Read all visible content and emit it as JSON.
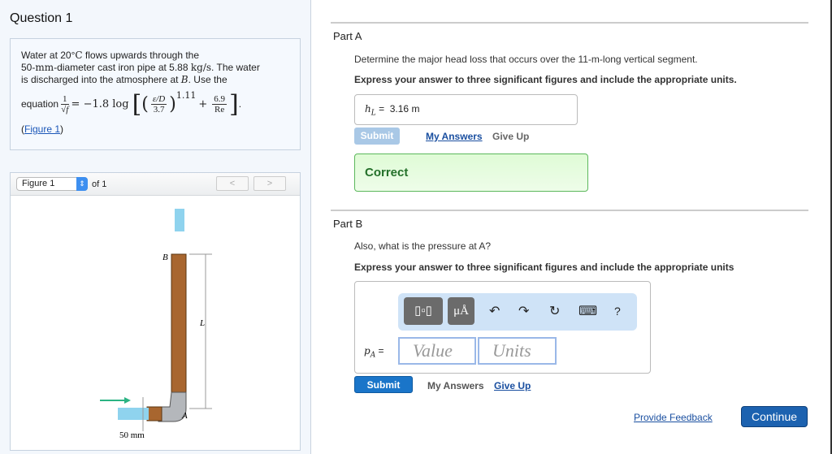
{
  "question_title": "Question 1",
  "problem": {
    "line1a": "Water at 20",
    "line1deg": "°",
    "line1C": "C",
    "line1b": " flows upwards through the",
    "line2a": "50-",
    "line2mm": "mm",
    "line2b": "-diameter cast iron pipe at 5.88 ",
    "line2unit": "kg/s",
    "line2c": ". The water",
    "line3a": "is discharged into the atmosphere at ",
    "line3B": "B",
    "line3b": ". Use the",
    "eq_label": "equation",
    "eq_num": "1",
    "eq_den": "√f",
    "eq_mid": "= −1.8 log",
    "eq_inner_num": "ε/D",
    "eq_inner_den": "3.7",
    "eq_exp": "1.11",
    "eq_plus": "+",
    "eq_re_num": "6.9",
    "eq_re_den": "Re",
    "figure_link": "Figure 1"
  },
  "figure": {
    "select": "Figure 1",
    "of": "of 1",
    "prev": "<",
    "next": ">",
    "labels": {
      "B": "B",
      "L": "L",
      "A": "A",
      "dia": "50 mm"
    }
  },
  "partA": {
    "title": "Part A",
    "prompt": "Determine the major head loss that occurs over the 11-m-long vertical segment.",
    "instruction": "Express your answer to three significant figures and include the appropriate units.",
    "var": "h",
    "sub": "L",
    "eq": "=",
    "answer": "3.16 m",
    "submit": "Submit",
    "my_answers": "My Answers",
    "give_up": "Give Up",
    "result": "Correct"
  },
  "partB": {
    "title": "Part B",
    "prompt": "Also, what is the pressure at A?",
    "instruction": "Express your answer to three significant figures and include the appropriate units",
    "toolbar": {
      "units": "μÅ",
      "undo": "↶",
      "redo": "↷",
      "reset": "↻",
      "keyboard": "⌨",
      "help": "?"
    },
    "var": "p",
    "sub": "A",
    "eq": "=",
    "value_placeholder": "Value",
    "units_placeholder": "Units",
    "submit": "Submit",
    "my_answers": "My Answers",
    "give_up": "Give Up"
  },
  "footer": {
    "feedback": "Provide Feedback",
    "continue": "Continue"
  }
}
